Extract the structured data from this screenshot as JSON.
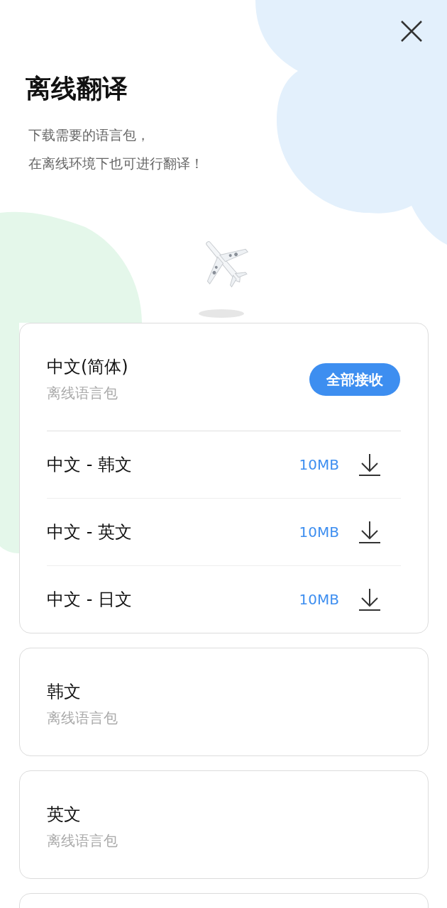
{
  "title": "离线翻译",
  "subtitle_lines": [
    "下载需要的语言包，",
    "在离线环境下也可进行翻译！"
  ],
  "languages": [
    {
      "name": "中文(简体)",
      "subtitle": "离线语言包",
      "action": "全部接收",
      "expanded": true,
      "pairs": [
        {
          "name": "中文 - 韩文",
          "size": "10MB"
        },
        {
          "name": "中文 - 英文",
          "size": "10MB"
        },
        {
          "name": "中文 - 日文",
          "size": "10MB"
        }
      ]
    },
    {
      "name": "韩文",
      "subtitle": "离线语言包",
      "expanded": false
    },
    {
      "name": "英文",
      "subtitle": "离线语言包",
      "expanded": false
    }
  ]
}
